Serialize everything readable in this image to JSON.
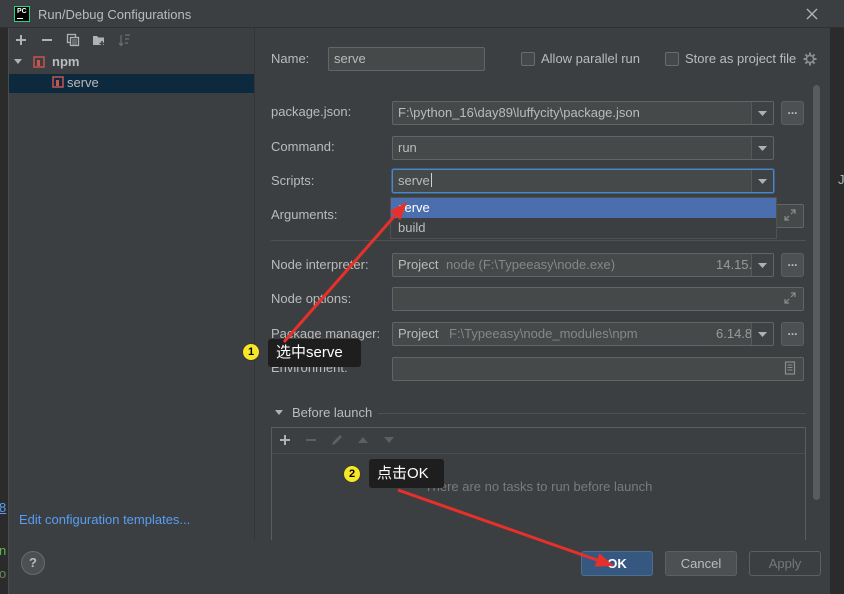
{
  "window": {
    "title": "Run/Debug Configurations",
    "logo_text": "PC",
    "logo_icon": "pycharm-logo-icon",
    "close_icon": "close-icon"
  },
  "sidebar": {
    "toolbar": [
      "add-icon",
      "remove-icon",
      "copy-icon",
      "new-folder-icon",
      "sort-icon"
    ],
    "tree": [
      {
        "label": "npm",
        "icon": "npm-icon",
        "expanded": true
      },
      {
        "label": "serve",
        "icon": "npm-config-icon",
        "selected": true
      }
    ],
    "edit_templates_link": "Edit configuration templates..."
  },
  "form": {
    "name": {
      "label": "Name:",
      "value": "serve"
    },
    "allow_parallel_run": {
      "label": "Allow parallel run",
      "checked": false
    },
    "store_as_project_file": {
      "label": "Store as project file",
      "checked": false,
      "icon": "gear-icon"
    },
    "package_json": {
      "label": "package.json:",
      "value": "F:\\python_16\\day89\\luffycity\\package.json"
    },
    "command": {
      "label": "Command:",
      "value": "run"
    },
    "scripts": {
      "label": "Scripts:",
      "value": "serve",
      "options": [
        "serve",
        "build"
      ],
      "highlighted": "serve"
    },
    "arguments": {
      "label": "Arguments:"
    },
    "node_interpreter": {
      "label": "Node interpreter:",
      "kind": "Project",
      "path": "node (F:\\Typeeasy\\node.exe)",
      "version": "14.15.1"
    },
    "node_options": {
      "label": "Node options:"
    },
    "package_manager": {
      "label": "Package manager:",
      "kind": "Project",
      "path": "F:\\Typeeasy\\node_modules\\npm",
      "version": "6.14.8"
    },
    "environment": {
      "label": "Environment:"
    },
    "browse_label": "...",
    "before_launch": {
      "label": "Before launch",
      "empty_text": "There are no tasks to run before launch",
      "toolbar": [
        "add-icon",
        "remove-icon",
        "edit-icon",
        "move-up-icon",
        "move-down-icon"
      ]
    }
  },
  "footer": {
    "help_label": "?",
    "ok_label": "OK",
    "cancel_label": "Cancel",
    "apply_label": "Apply",
    "apply_enabled": false
  },
  "annotations": [
    {
      "number": "1",
      "text": "选中serve"
    },
    {
      "number": "2",
      "text": "点击OK"
    }
  ],
  "background_fragments": {
    "left": [
      "8",
      "n",
      "o"
    ],
    "right": "J"
  },
  "colors": {
    "dialog_bg": "#3c3f41",
    "field_bg": "#45494a",
    "selection": "#0d293e",
    "accent": "#4b6eaf",
    "ok_button": "#365880",
    "link": "#589df6",
    "annotation_arrow": "#e8302a",
    "annotation_badge": "#f6e727"
  }
}
